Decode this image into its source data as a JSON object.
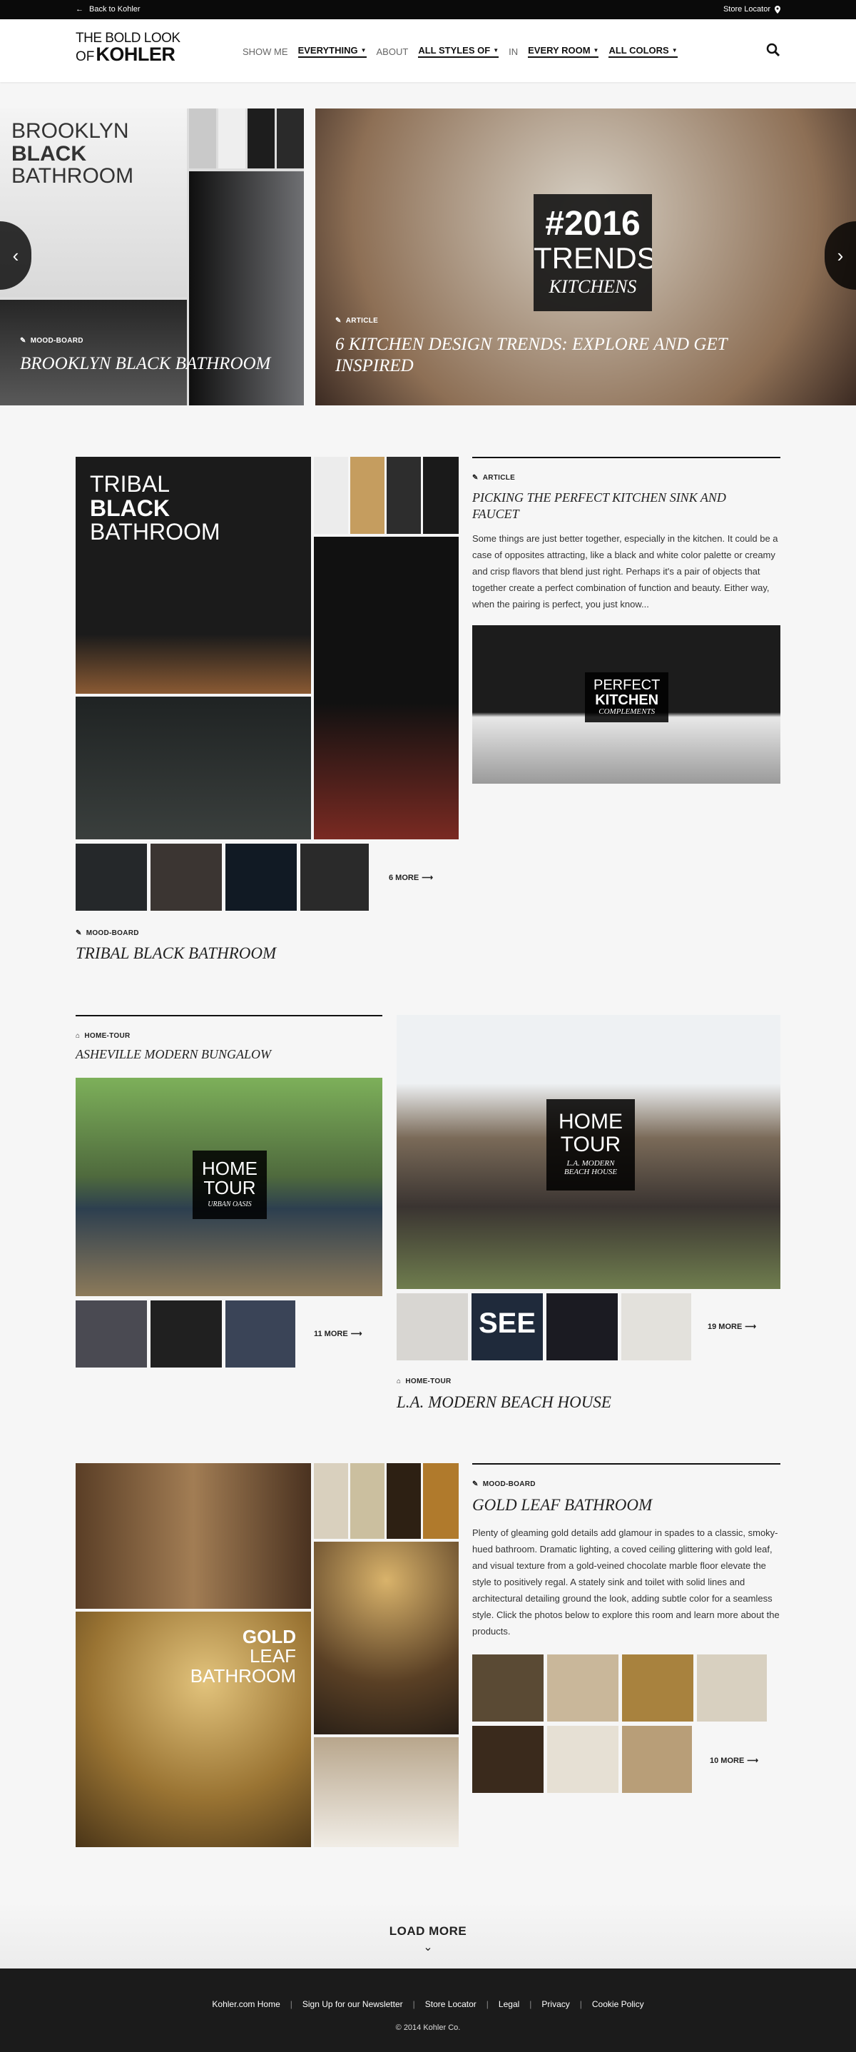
{
  "topbar": {
    "back_label": "Back to Kohler",
    "store_locator": "Store Locator"
  },
  "header": {
    "logo_line1": "THE BOLD LOOK",
    "logo_of": "OF",
    "logo_brand": "KOHLER",
    "show_me": "SHOW ME",
    "filter_everything": "EVERYTHING",
    "about": "ABOUT",
    "filter_styles": "ALL STYLES OF",
    "in": "IN",
    "filter_room": "EVERY ROOM",
    "filter_colors": "ALL COLORS"
  },
  "hero": {
    "slide1": {
      "overlay_l1": "BROOKLYN",
      "overlay_l2": "BLACK",
      "overlay_l3": "BATHROOM",
      "tag": "MOOD-BOARD",
      "title": "BROOKLYN BLACK BATHROOM"
    },
    "slide2": {
      "badge_l1": "#2016",
      "badge_l2": "TRENDS",
      "badge_l3": "KITCHENS",
      "tag": "ARTICLE",
      "title": "6 KITCHEN DESIGN TRENDS: EXPLORE AND GET INSPIRED"
    }
  },
  "tribal": {
    "overlay_l1": "TRIBAL",
    "overlay_l2": "BLACK",
    "overlay_l3": "BATHROOM",
    "more": "6 MORE",
    "tag": "MOOD-BOARD",
    "title": "TRIBAL BLACK BATHROOM"
  },
  "sink_article": {
    "tag": "ARTICLE",
    "title": "PICKING THE PERFECT KITCHEN SINK AND FAUCET",
    "body": "Some things are just better together, especially in the kitchen. It could be a case of opposites attracting, like a black and white color palette or creamy and crisp flavors that blend just right. Perhaps it's a pair of objects that together create a perfect combination of function and beauty. Either way, when the pairing is perfect, you just know...",
    "image_l1": "PERFECT",
    "image_l2": "KITCHEN",
    "image_l3": "COMPLEMENTS"
  },
  "asheville": {
    "tag": "HOME-TOUR",
    "title": "ASHEVILLE MODERN BUNGALOW",
    "badge_l1": "HOME",
    "badge_l2": "TOUR",
    "badge_sub": "URBAN OASIS",
    "more": "11 MORE"
  },
  "la_house": {
    "badge_l1": "HOME",
    "badge_l2": "TOUR",
    "badge_sub1": "L.A. MODERN",
    "badge_sub2": "BEACH HOUSE",
    "sign_text": "SEE",
    "more": "19 MORE",
    "tag": "HOME-TOUR",
    "title": "L.A. MODERN BEACH HOUSE"
  },
  "gold": {
    "overlay_l1": "GOLD",
    "overlay_l2": "LEAF",
    "overlay_l3": "BATHROOM",
    "tag": "MOOD-BOARD",
    "title": "GOLD LEAF BATHROOM",
    "body": "Plenty of gleaming gold details add glamour in spades to a classic, smoky-hued bathroom. Dramatic lighting, a coved ceiling glittering with gold leaf, and visual texture from a gold-veined chocolate marble floor elevate the style to positively regal. A stately sink and toilet with solid lines and architectural detailing ground the look, adding subtle color for a seamless style. Click the photos below to explore this room and learn more about the products.",
    "more": "10 MORE"
  },
  "load_more": "LOAD MORE",
  "footer": {
    "links": [
      "Kohler.com Home",
      "Sign Up for our Newsletter",
      "Store Locator",
      "Legal",
      "Privacy",
      "Cookie Policy"
    ],
    "copyright": "© 2014 Kohler Co."
  }
}
